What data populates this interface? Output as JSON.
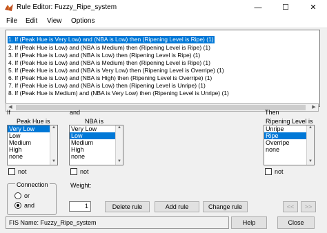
{
  "window": {
    "title": "Rule Editor: Fuzzy_Ripe_system",
    "minimize": "—",
    "maximize": "☐",
    "close": "✕"
  },
  "menu": [
    "File",
    "Edit",
    "View",
    "Options"
  ],
  "rules": [
    "1. If (Peak Hue is Very Low) and (NBA is Low) then (Ripening Level is Ripe) (1)",
    "2. If (Peak Hue is Low) and (NBA is Medium) then (Ripening Level is Ripe) (1)",
    "3. If (Peak Hue is Low) and (NBA is Low) then (Ripening Level is Ripe) (1)",
    "4. If (Peak Hue is Low) and (NBA is Medium) then (Ripening Level is Ripe) (1)",
    "5. If (Peak Hue is Low) and (NBA is Very Low) then (Ripening Level is Overripe) (1)",
    "6. If (Peak Hue is Low) and (NBA is High) then (Ripening Level is Overripe) (1)",
    "7. If (Peak Hue is Low) and (NBA is Low) then (Ripening Level is Unripe) (1)",
    "8. If (Peak Hue is Medium) and (NBA is Very Low) then (Ripening Level is Unripe) (1)"
  ],
  "selected_rule": 0,
  "if_label": "If",
  "and_label": "and",
  "then_label": "Then",
  "input1": {
    "label": "Peak Hue is",
    "items": [
      "Very Low",
      "Low",
      "Medium",
      "High",
      "none"
    ],
    "selected": 0,
    "not_label": "not"
  },
  "input2": {
    "label": "NBA is",
    "items": [
      "Very Low",
      "Low",
      "Medium",
      "High",
      "none"
    ],
    "selected": 1,
    "not_label": "not"
  },
  "output": {
    "label": "Ripening Level is",
    "items": [
      "Unripe",
      "Ripe",
      "Overripe",
      "none"
    ],
    "selected": 1,
    "not_label": "not"
  },
  "connection": {
    "label": "Connection",
    "options": [
      "or",
      "and"
    ],
    "selected": "and"
  },
  "weight": {
    "label": "Weight:",
    "value": "1"
  },
  "buttons": {
    "delete": "Delete rule",
    "add": "Add rule",
    "change": "Change rule",
    "prev": "<<",
    "next": ">>",
    "help": "Help",
    "close": "Close"
  },
  "status": "FIS Name: Fuzzy_Ripe_system",
  "colors": {
    "selection": "#0078d7",
    "window_bg": "#f0f0f0"
  }
}
